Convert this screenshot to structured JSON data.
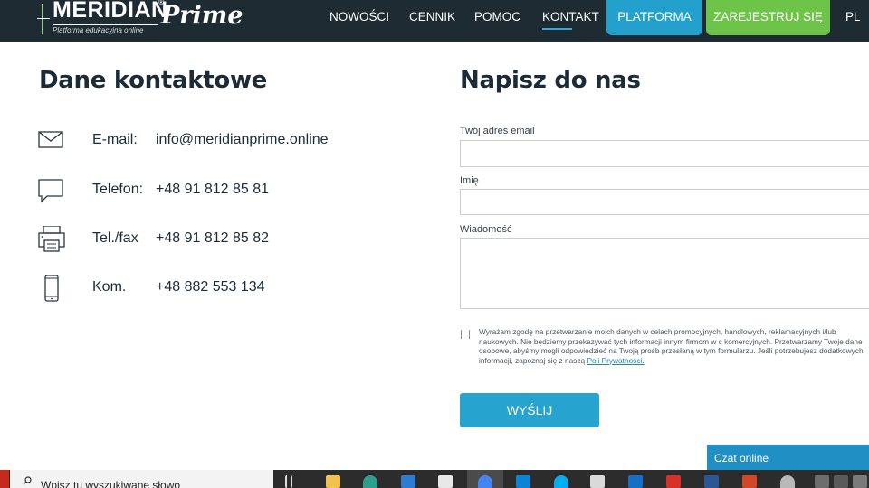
{
  "header": {
    "logo": {
      "name": "MERIDIAN",
      "registered": "®",
      "script": "Prime",
      "tagline": "Platforma edukacyjna online"
    },
    "nav": [
      "NOWOŚCI",
      "CENNIK",
      "POMOC",
      "KONTAKT"
    ],
    "active_nav": "KONTAKT",
    "platform_button": "PLATFORMA",
    "register_button": "ZAREJESTRUJ SIĘ",
    "language": "PL"
  },
  "contact": {
    "title": "Dane kontaktowe",
    "items": [
      {
        "icon": "envelope-icon",
        "label": "E-mail:",
        "value": "info@meridianprime.online"
      },
      {
        "icon": "chat-bubble-icon",
        "label": "Telefon:",
        "value": "+48 91 812 85 81"
      },
      {
        "icon": "fax-icon",
        "label": "Tel./fax",
        "value": "+48 91 812 85 82"
      },
      {
        "icon": "mobile-phone-icon",
        "label": "Kom.",
        "value": "+48 882 553 134"
      }
    ]
  },
  "form": {
    "title": "Napisz do nas",
    "email_label": "Twój adres email",
    "name_label": "Imię",
    "message_label": "Wiadomość",
    "email_value": "",
    "name_value": "",
    "message_value": "",
    "consent_checked": false,
    "consent_text": "Wyrażam zgodę na przetwarzanie moich danych w celach promocyjnych, handlowych, reklamacyjnych i/lub naukowych. Nie będziemy przekazywać tych informacji innym firmom w c komercyjnych. Przetwarzamy Twoje dane osobowe, abyśmy mogli odpowiedzieć na Twoją prośb przesłaną w tym formularzu. Jeśli potrzebujesz dodatkowych informacji, zapoznaj się z naszą ",
    "consent_link": "Poli Prywatności.",
    "submit_label": "WYŚLIJ"
  },
  "chat": {
    "label": "Czat online"
  },
  "taskbar": {
    "search_placeholder": "Wpisz tu wyszukiwane słowo",
    "apps": [
      "task-view-icon",
      "file-explorer-icon",
      "edge-icon",
      "mail-icon",
      "store-icon",
      "chrome-icon",
      "windows-icon",
      "skype-icon",
      "gift-icon",
      "outlook-icon",
      "acrobat-icon",
      "word-icon",
      "powerpoint-icon",
      "paint-icon",
      "app-icon",
      "camera-icon",
      "tool-icon"
    ]
  },
  "colors": {
    "header_bg": "#1e2b33",
    "accent_blue": "#24a0cc",
    "accent_green": "#6ec448",
    "text_dark": "#1d2b36"
  }
}
